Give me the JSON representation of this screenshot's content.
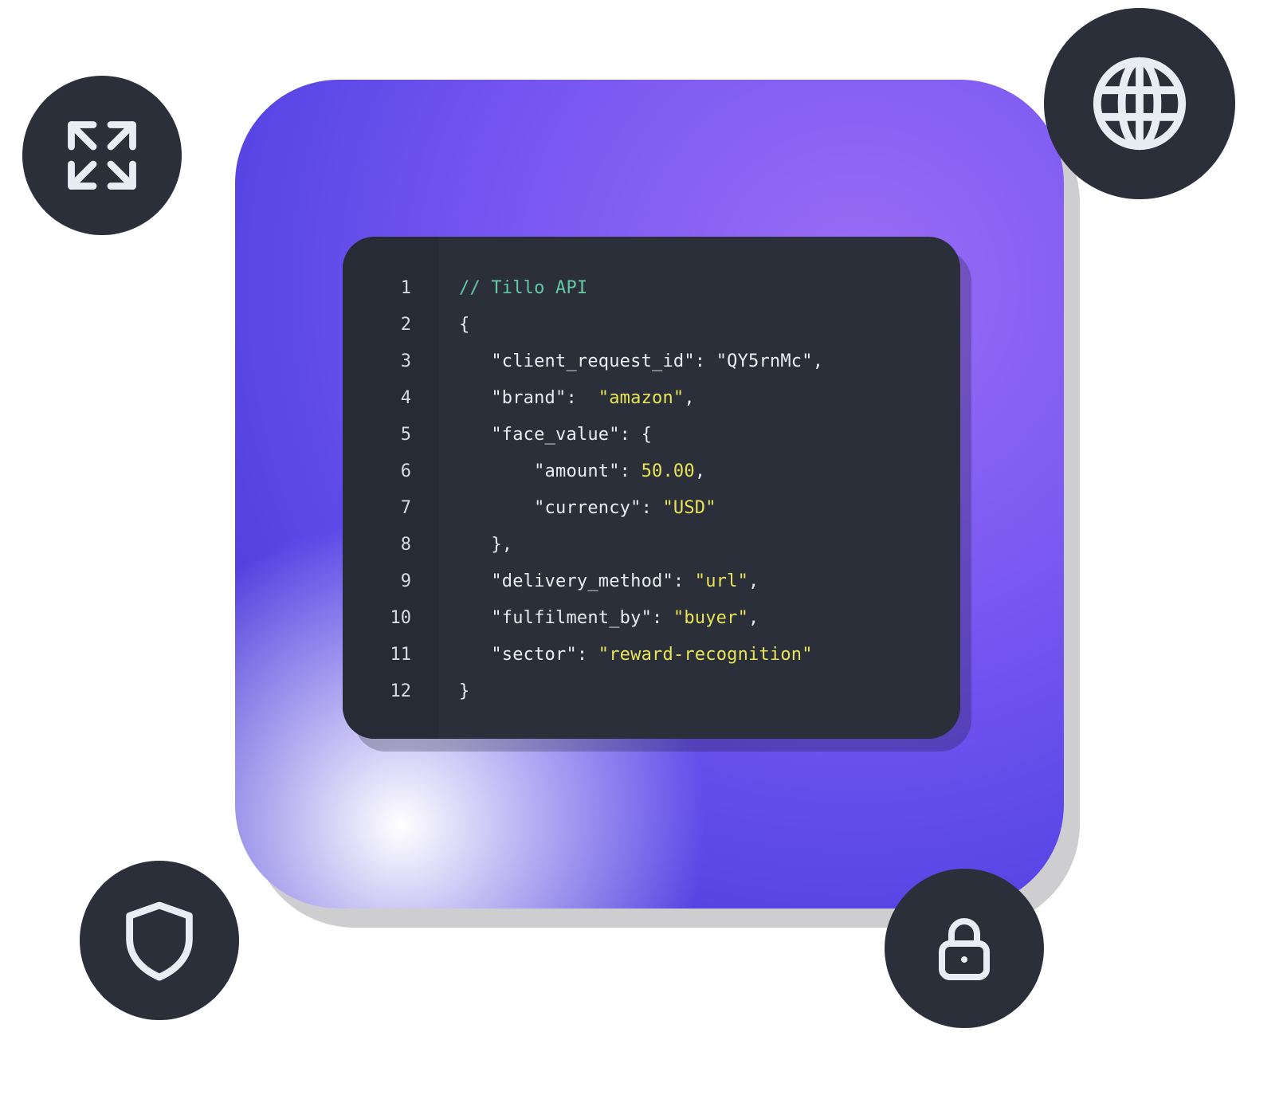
{
  "icons": {
    "expand": "expand-icon",
    "globe": "globe-icon",
    "shield": "shield-icon",
    "lock": "lock-icon"
  },
  "colors": {
    "panel_bg": "#2b2f3a",
    "gradient_from": "#9a6ef5",
    "gradient_to": "#4b3cd9",
    "highlight": "#e9e457",
    "comment": "#64c9a2",
    "text": "#e9ecf2"
  },
  "code": {
    "line_numbers": [
      "1",
      "2",
      "3",
      "4",
      "5",
      "6",
      "7",
      "8",
      "9",
      "10",
      "11",
      "12"
    ],
    "tokens": [
      [
        {
          "t": "// Tillo API",
          "c": "tok-comment"
        }
      ],
      [
        {
          "t": "{",
          "c": "tok-punc"
        }
      ],
      [
        {
          "t": "   \"client_request_id\": ",
          "c": "tok-key"
        },
        {
          "t": "\"QY5rnMc\"",
          "c": "tok-val"
        },
        {
          "t": ",",
          "c": "tok-punc"
        }
      ],
      [
        {
          "t": "   \"brand\":  ",
          "c": "tok-key"
        },
        {
          "t": "\"amazon\"",
          "c": "tok-hi"
        },
        {
          "t": ",",
          "c": "tok-punc"
        }
      ],
      [
        {
          "t": "   \"face_value\": {",
          "c": "tok-key"
        }
      ],
      [
        {
          "t": "       \"amount\": ",
          "c": "tok-key"
        },
        {
          "t": "50.00",
          "c": "tok-num"
        },
        {
          "t": ",",
          "c": "tok-punc"
        }
      ],
      [
        {
          "t": "       \"currency\": ",
          "c": "tok-key"
        },
        {
          "t": "\"USD\"",
          "c": "tok-hi"
        }
      ],
      [
        {
          "t": "   },",
          "c": "tok-punc"
        }
      ],
      [
        {
          "t": "   \"delivery_method\": ",
          "c": "tok-key"
        },
        {
          "t": "\"url\"",
          "c": "tok-hi"
        },
        {
          "t": ",",
          "c": "tok-punc"
        }
      ],
      [
        {
          "t": "   \"fulfilment_by\": ",
          "c": "tok-key"
        },
        {
          "t": "\"buyer\"",
          "c": "tok-hi"
        },
        {
          "t": ",",
          "c": "tok-punc"
        }
      ],
      [
        {
          "t": "   \"sector\": ",
          "c": "tok-key"
        },
        {
          "t": "\"reward-recognition\"",
          "c": "tok-hi"
        }
      ],
      [
        {
          "t": "}",
          "c": "tok-punc"
        }
      ]
    ]
  },
  "api_payload": {
    "client_request_id": "QY5rnMc",
    "brand": "amazon",
    "face_value": {
      "amount": 50.0,
      "currency": "USD"
    },
    "delivery_method": "url",
    "fulfilment_by": "buyer",
    "sector": "reward-recognition"
  }
}
